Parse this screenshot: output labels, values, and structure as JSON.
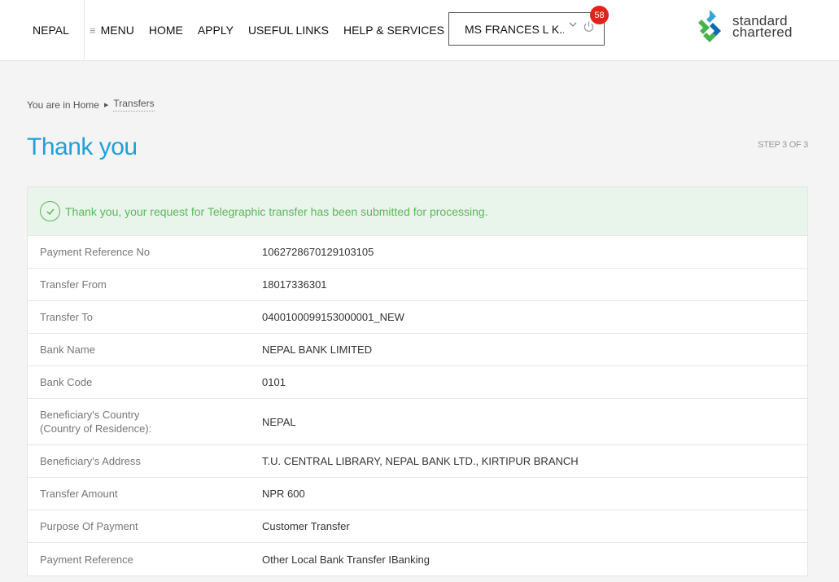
{
  "header": {
    "country": "NEPAL",
    "nav": [
      {
        "label": "MENU"
      },
      {
        "label": "HOME"
      },
      {
        "label": "APPLY"
      },
      {
        "label": "USEFUL LINKS"
      },
      {
        "label": "HELP & SERVICES"
      }
    ],
    "user_name": "MS FRANCES L K...",
    "notification_count": "58",
    "logo": {
      "line1": "standard",
      "line2": "chartered"
    }
  },
  "breadcrumb": {
    "prefix": "You are in Home",
    "current": "Transfers"
  },
  "page": {
    "title": "Thank you",
    "step": "STEP 3 OF 3"
  },
  "success_message": "Thank you, your request for Telegraphic transfer has been submitted for processing.",
  "details": [
    {
      "label": "Payment Reference No",
      "value": "1062728670129103105"
    },
    {
      "label": "Transfer From",
      "value": "18017336301"
    },
    {
      "label": "Transfer To",
      "value": "0400100099153000001_NEW"
    },
    {
      "label": "Bank Name",
      "value": "NEPAL BANK LIMITED"
    },
    {
      "label": "Bank Code",
      "value": "0101"
    },
    {
      "label": "Beneficiary's Country (Country of Residence):",
      "label_line1": "Beneficiary's Country",
      "label_line2": "(Country of Residence):",
      "value": "NEPAL"
    },
    {
      "label": "Beneficiary's Address",
      "value": "T.U. CENTRAL LIBRARY, NEPAL BANK LTD., KIRTIPUR BRANCH"
    },
    {
      "label": "Transfer Amount",
      "value": "NPR 600"
    },
    {
      "label": "Purpose Of Payment",
      "value": "Customer Transfer"
    },
    {
      "label": "Payment Reference",
      "value": "Other Local Bank Transfer IBanking"
    }
  ],
  "colors": {
    "accent": "#1fa1d8",
    "success": "#5cb85c",
    "badge": "#e2231a"
  }
}
